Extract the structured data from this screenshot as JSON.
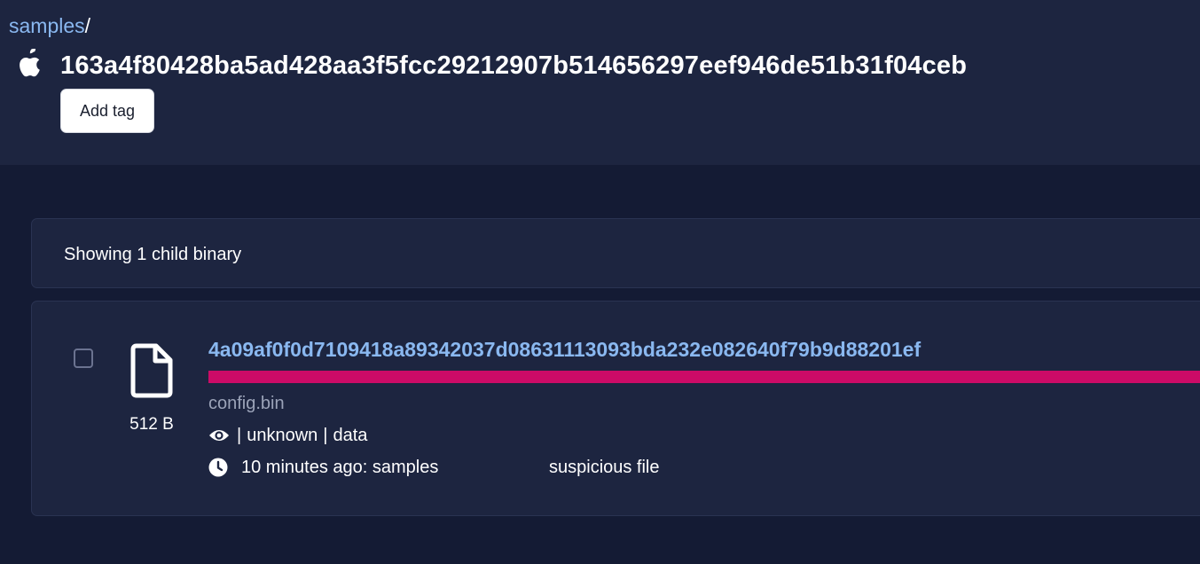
{
  "header": {
    "breadcrumb_link": "samples",
    "breadcrumb_separator": "/",
    "os_icon": "apple-icon",
    "sha256": "163a4f80428ba5ad428aa3f5fcc29212907b514656297eef946de51b31f04ceb",
    "add_tag_label": "Add tag"
  },
  "children": {
    "count_text": "Showing 1 child binary",
    "items": [
      {
        "sha256": "4a09af0f0d7109418a89342037d08631113093bda232e082640f79b9d88201ef",
        "filename": "config.bin",
        "size": "512 B",
        "file_icon": "file-icon",
        "visibility_icon": "eye-icon",
        "meta_sep1": "|",
        "type": "unknown",
        "meta_sep2": "|",
        "category": "data",
        "time_icon": "clock-icon",
        "time_text": "10 minutes ago: samples",
        "label": "suspicious file",
        "bar_fill": 1.0,
        "bar_color": "#cc0b67"
      }
    ]
  },
  "colors": {
    "background": "#141b34",
    "panel": "#1d2540",
    "link": "#8ab8f0",
    "accent_bar": "#cc0b67"
  }
}
